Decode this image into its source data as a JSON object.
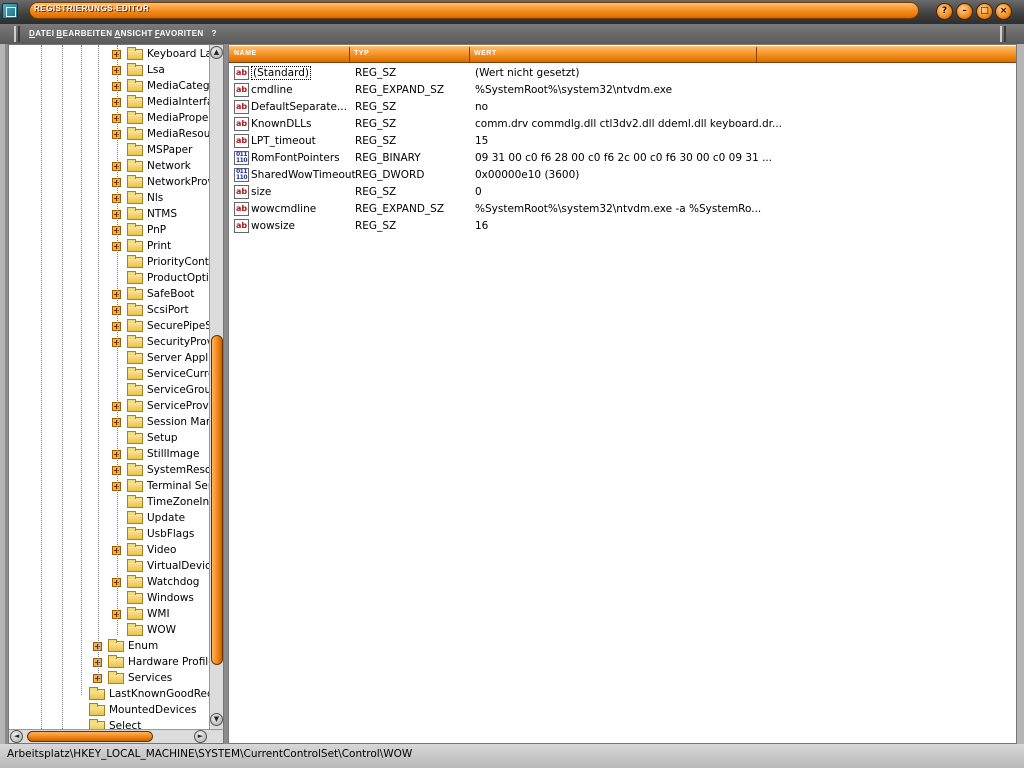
{
  "window": {
    "title": "Registrierungs-Editor"
  },
  "menu": [
    "Datei",
    "Bearbeiten",
    "Ansicht",
    "Favoriten",
    "?"
  ],
  "window_buttons": {
    "help": "?",
    "minimize": "–",
    "maximize": "□",
    "close": "×"
  },
  "tree": {
    "items": [
      {
        "label": "Keyboard La",
        "expander": "plus"
      },
      {
        "label": "Lsa",
        "expander": "plus"
      },
      {
        "label": "MediaCateg",
        "expander": "plus"
      },
      {
        "label": "MediaInterfa",
        "expander": "plus"
      },
      {
        "label": "MediaProper",
        "expander": "plus"
      },
      {
        "label": "MediaResou",
        "expander": "plus"
      },
      {
        "label": "MSPaper",
        "expander": "none"
      },
      {
        "label": "Network",
        "expander": "plus"
      },
      {
        "label": "NetworkProv",
        "expander": "plus"
      },
      {
        "label": "Nls",
        "expander": "plus"
      },
      {
        "label": "NTMS",
        "expander": "plus"
      },
      {
        "label": "PnP",
        "expander": "plus"
      },
      {
        "label": "Print",
        "expander": "plus"
      },
      {
        "label": "PriorityContr",
        "expander": "none"
      },
      {
        "label": "ProductOptio",
        "expander": "none"
      },
      {
        "label": "SafeBoot",
        "expander": "plus"
      },
      {
        "label": "ScsiPort",
        "expander": "plus"
      },
      {
        "label": "SecurePipeS",
        "expander": "plus"
      },
      {
        "label": "SecurityProv",
        "expander": "plus"
      },
      {
        "label": "Server Appli",
        "expander": "none"
      },
      {
        "label": "ServiceCurre",
        "expander": "none"
      },
      {
        "label": "ServiceGrou",
        "expander": "none"
      },
      {
        "label": "ServiceProvi",
        "expander": "plus"
      },
      {
        "label": "Session Man",
        "expander": "plus"
      },
      {
        "label": "Setup",
        "expander": "none"
      },
      {
        "label": "StillImage",
        "expander": "plus"
      },
      {
        "label": "SystemReso",
        "expander": "plus"
      },
      {
        "label": "Terminal Ser",
        "expander": "plus"
      },
      {
        "label": "TimeZoneInf",
        "expander": "none"
      },
      {
        "label": "Update",
        "expander": "none"
      },
      {
        "label": "UsbFlags",
        "expander": "none"
      },
      {
        "label": "Video",
        "expander": "plus"
      },
      {
        "label": "VirtualDevice",
        "expander": "none"
      },
      {
        "label": "Watchdog",
        "expander": "plus"
      },
      {
        "label": "Windows",
        "expander": "none"
      },
      {
        "label": "WMI",
        "expander": "plus"
      },
      {
        "label": "WOW",
        "expander": "none",
        "selected": true
      }
    ],
    "parent_items": [
      {
        "label": "Enum",
        "expander": "plus"
      },
      {
        "label": "Hardware Profile",
        "expander": "plus"
      },
      {
        "label": "Services",
        "expander": "plus"
      }
    ],
    "root_items": [
      {
        "label": "LastKnownGoodRec",
        "expander": "none"
      },
      {
        "label": "MountedDevices",
        "expander": "none"
      },
      {
        "label": "Select",
        "expander": "none"
      }
    ],
    "scroll": {
      "up": "▲",
      "down": "▼",
      "left": "◄",
      "right": "►"
    }
  },
  "list": {
    "columns": [
      "Name",
      "Typ",
      "Wert"
    ],
    "rows": [
      {
        "icon": "ab",
        "kind": "str",
        "name": "(Standard)",
        "type": "REG_SZ",
        "value": "(Wert nicht gesetzt)"
      },
      {
        "icon": "ab",
        "kind": "str",
        "name": "cmdline",
        "type": "REG_EXPAND_SZ",
        "value": "%SystemRoot%\\system32\\ntvdm.exe"
      },
      {
        "icon": "ab",
        "kind": "str",
        "name": "DefaultSeparate...",
        "type": "REG_SZ",
        "value": "no"
      },
      {
        "icon": "ab",
        "kind": "str",
        "name": "KnownDLLs",
        "type": "REG_SZ",
        "value": "comm.drv commdlg.dll ctl3dv2.dll ddeml.dll keyboard.dr..."
      },
      {
        "icon": "ab",
        "kind": "str",
        "name": "LPT_timeout",
        "type": "REG_SZ",
        "value": "15"
      },
      {
        "icon": "011 110",
        "kind": "bin",
        "name": "RomFontPointers",
        "type": "REG_BINARY",
        "value": "09 31 00 c0 f6 28 00 c0 f6 2c 00 c0 f6 30 00 c0 09 31 ..."
      },
      {
        "icon": "011 110",
        "kind": "bin",
        "name": "SharedWowTimeout",
        "type": "REG_DWORD",
        "value": "0x00000e10 (3600)"
      },
      {
        "icon": "ab",
        "kind": "str",
        "name": "size",
        "type": "REG_SZ",
        "value": "0"
      },
      {
        "icon": "ab",
        "kind": "str",
        "name": "wowcmdline",
        "type": "REG_EXPAND_SZ",
        "value": "%SystemRoot%\\system32\\ntvdm.exe -a %SystemRo..."
      },
      {
        "icon": "ab",
        "kind": "str",
        "name": "wowsize",
        "type": "REG_SZ",
        "value": "16"
      }
    ]
  },
  "status": {
    "path": "Arbeitsplatz\\HKEY_LOCAL_MACHINE\\SYSTEM\\CurrentControlSet\\Control\\WOW"
  },
  "colors": {
    "accent": "#f38b1b",
    "chrome": "#5a5a5a",
    "selected_bg": "#ffffff"
  }
}
